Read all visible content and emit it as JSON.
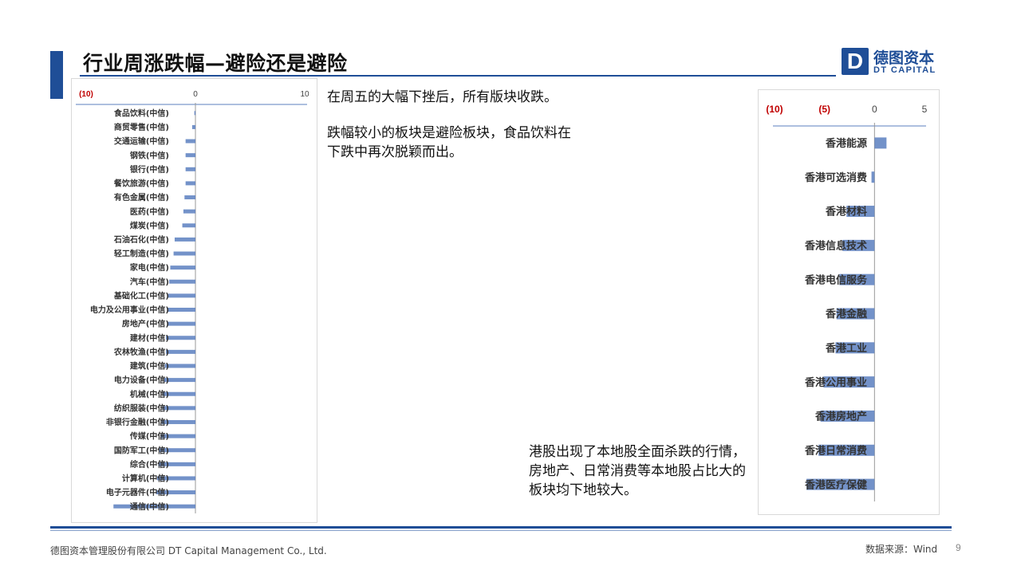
{
  "header": {
    "title": "行业周涨跌幅—避险还是避险"
  },
  "logo": {
    "mark": "D",
    "name_cn": "德图资本",
    "name_en": "DT CAPITAL"
  },
  "body": {
    "paragraph1": "在周五的大幅下挫后，所有版块收跌。",
    "paragraph2": "跌幅较小的板块是避险板块，食品饮料在下跌中再次脱颖而出。",
    "paragraph3": "港股出现了本地股全面杀跌的行情，房地产、日常消费等本地股占比大的板块均下地较大。"
  },
  "footer": {
    "company": "德图资本管理股份有限公司  DT Capital  Management  Co., Ltd.",
    "source": "数据来源：Wind",
    "page": "9"
  },
  "colors": {
    "brand": "#1f4e97",
    "bar": "#5b7fbf",
    "negative_tick": "#c00000"
  },
  "chart_data": [
    {
      "type": "bar",
      "orientation": "horizontal",
      "categories": [
        "食品饮料(中信)",
        "商贸零售(中信)",
        "交通运输(中信)",
        "钢铁(中信)",
        "银行(中信)",
        "餐饮旅游(中信)",
        "有色金属(中信)",
        "医药(中信)",
        "煤炭(中信)",
        "石油石化(中信)",
        "轻工制造(中信)",
        "家电(中信)",
        "汽车(中信)",
        "基础化工(中信)",
        "电力及公用事业(中信)",
        "房地产(中信)",
        "建材(中信)",
        "农林牧渔(中信)",
        "建筑(中信)",
        "电力设备(中信)",
        "机械(中信)",
        "纺织服装(中信)",
        "非银行金融(中信)",
        "传媒(中信)",
        "国防军工(中信)",
        "综合(中信)",
        "计算机(中信)",
        "电子元器件(中信)",
        "通信(中信)"
      ],
      "values": [
        -0.1,
        -0.3,
        -0.9,
        -0.9,
        -0.9,
        -0.9,
        -1.0,
        -1.1,
        -1.2,
        -1.9,
        -2.0,
        -2.3,
        -2.4,
        -2.5,
        -2.6,
        -2.6,
        -2.7,
        -2.7,
        -2.8,
        -2.9,
        -3.0,
        -3.0,
        -3.1,
        -3.2,
        -3.3,
        -3.4,
        -3.5,
        -3.6,
        -7.5
      ],
      "xlim": [
        -10,
        10
      ],
      "xticks": [
        "(10)",
        "0",
        "10"
      ]
    },
    {
      "type": "bar",
      "orientation": "horizontal",
      "categories": [
        "香港能源",
        "香港可选消费",
        "香港材料",
        "香港信息技术",
        "香港电信服务",
        "香港金融",
        "香港工业",
        "香港公用事业",
        "香港房地产",
        "香港日常消费",
        "香港医疗保健"
      ],
      "values": [
        1.2,
        -0.3,
        -2.8,
        -3.2,
        -3.5,
        -3.8,
        -3.9,
        -5.1,
        -5.4,
        -5.6,
        -6.8
      ],
      "xlim": [
        -10,
        5
      ],
      "xticks": [
        "(10)",
        "(5)",
        "0",
        "5"
      ]
    }
  ]
}
